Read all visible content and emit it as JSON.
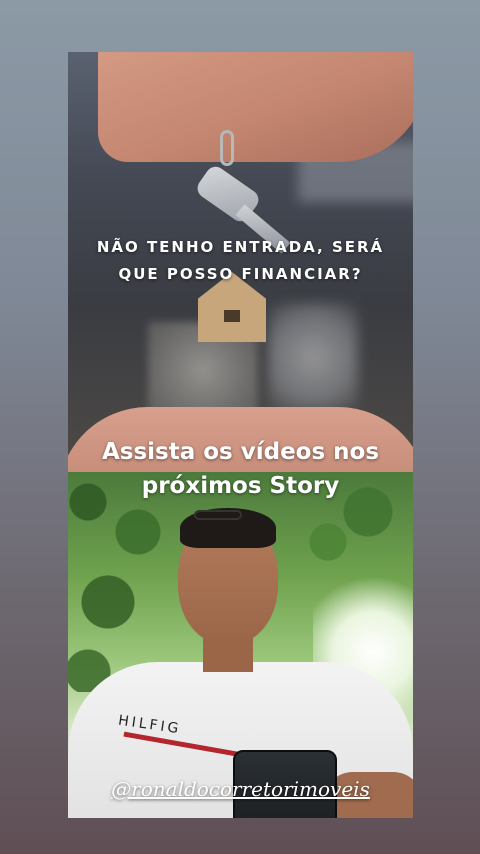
{
  "story": {
    "headline": [
      "NÃO TENHO ENTRADA, SERÁ",
      "QUE POSSO FINANCIAR?"
    ],
    "cta": [
      "Assista os vídeos nos",
      "próximos Story"
    ],
    "handle": "@ronaldocorretorimoveis",
    "shirt_logo": "HILFIG"
  },
  "colors": {
    "text": "#ffffff",
    "shirt_stripe": "#b3262e"
  }
}
